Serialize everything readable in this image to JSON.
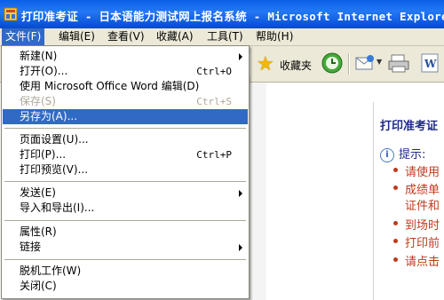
{
  "window": {
    "title": "打印准考证 - 日本语能力测试网上报名系统 - Microsoft Internet Explorer"
  },
  "menubar": {
    "items": [
      {
        "label": "文件(F)"
      },
      {
        "label": "编辑(E)"
      },
      {
        "label": "查看(V)"
      },
      {
        "label": "收藏(A)"
      },
      {
        "label": "工具(T)"
      },
      {
        "label": "帮助(H)"
      }
    ]
  },
  "toolbar": {
    "favorites_label": "收藏夹"
  },
  "file_menu": {
    "items": [
      {
        "label": "新建(N)",
        "shortcut": "",
        "submenu": true
      },
      {
        "label": "打开(O)...",
        "shortcut": "Ctrl+O"
      },
      {
        "label": "使用 Microsoft Office Word 编辑(D)",
        "shortcut": ""
      },
      {
        "label": "保存(S)",
        "shortcut": "Ctrl+S",
        "disabled": true
      },
      {
        "label": "另存为(A)...",
        "shortcut": "",
        "highlighted": true
      },
      {
        "label": "页面设置(U)...",
        "shortcut": ""
      },
      {
        "label": "打印(P)...",
        "shortcut": "Ctrl+P"
      },
      {
        "label": "打印预览(V)...",
        "shortcut": ""
      },
      {
        "label": "发送(E)",
        "shortcut": "",
        "submenu": true
      },
      {
        "label": "导入和导出(I)...",
        "shortcut": ""
      },
      {
        "label": "属性(R)",
        "shortcut": ""
      },
      {
        "label": "链接",
        "shortcut": "",
        "submenu": true
      },
      {
        "label": "脱机工作(W)",
        "shortcut": ""
      },
      {
        "label": "关闭(C)",
        "shortcut": ""
      }
    ]
  },
  "page": {
    "heading": "打印准考证",
    "hint_label": "提示:",
    "notices": [
      "请使用",
      "成绩单",
      "证件和",
      "到场时",
      "打印前",
      "请点击"
    ]
  },
  "colors": {
    "title_bar": "#0a5fe8",
    "menu_highlight": "#316ac5",
    "heading": "#1f2a8c",
    "notice": "#c23a1a"
  }
}
